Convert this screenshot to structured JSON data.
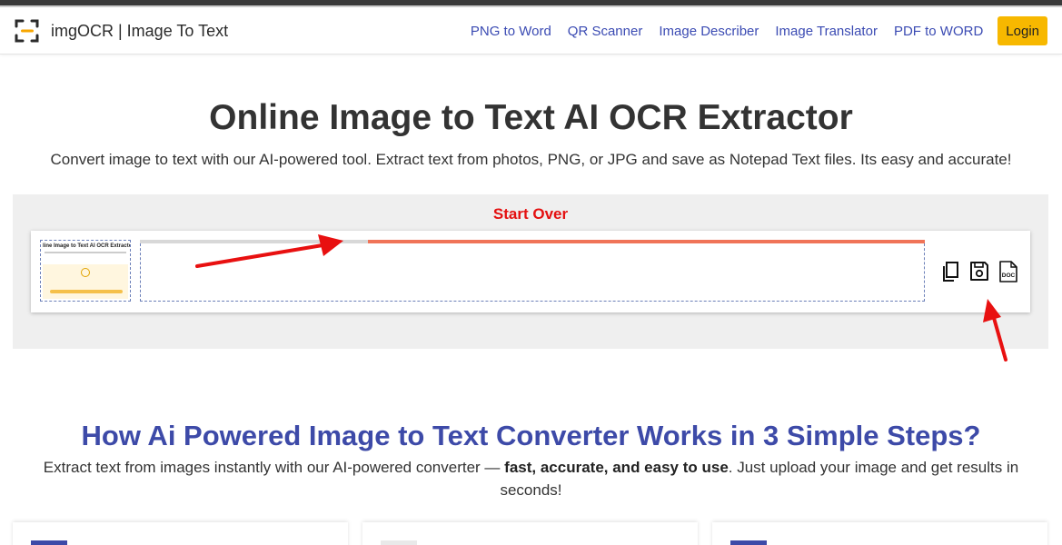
{
  "brand": {
    "name": "imgOCR | Image To Text"
  },
  "nav": {
    "links": [
      "PNG to Word",
      "QR Scanner",
      "Image Describer",
      "Image Translator",
      "PDF to WORD"
    ],
    "login_label": "Login"
  },
  "hero": {
    "title": "Online Image to Text AI OCR Extractor",
    "subtitle": "Convert image to text with our AI-powered tool. Extract text from photos, PNG, or JPG and save as Notepad Text files. Its easy and accurate!"
  },
  "tool": {
    "start_over_label": "Start Over",
    "thumbnail_title": "line Image to Text AI OCR Extracto",
    "progress_percent": 71,
    "actions": [
      "copy-icon",
      "save-icon",
      "doc-icon"
    ],
    "doc_icon_text": "DOC"
  },
  "steps": {
    "title": "How Ai Powered Image to Text Converter Works in 3 Simple Steps?",
    "subtitle_before": "Extract text from images instantly with our AI-powered converter — ",
    "subtitle_bold": "fast, accurate, and easy to use",
    "subtitle_after": ". Just upload your image and get results in seconds!"
  },
  "colors": {
    "accent": "#3d4aa8",
    "link": "#3b4bb3",
    "login": "#f7b800",
    "start_over": "#e41010",
    "progress": "#f07458",
    "annotation_arrow": "#e81010"
  }
}
